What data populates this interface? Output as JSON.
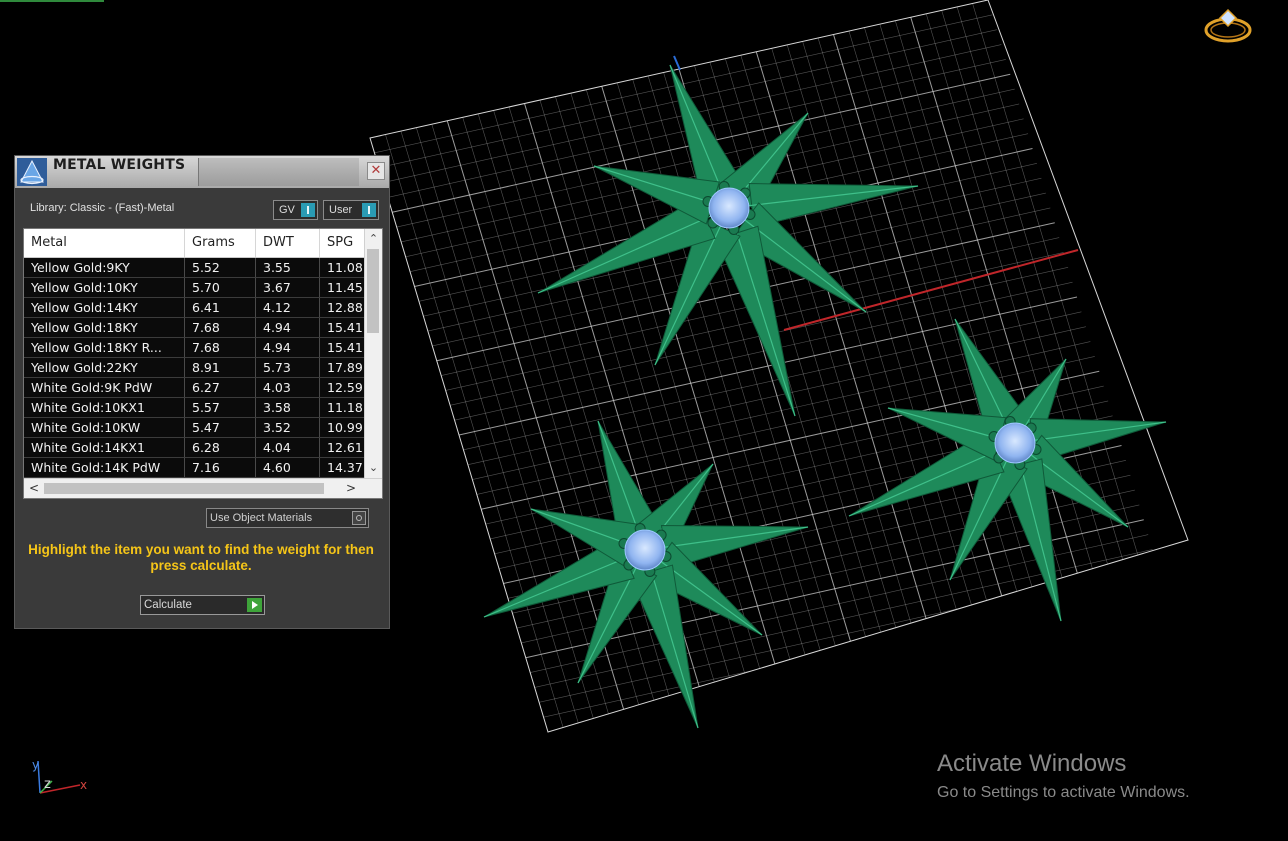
{
  "panel": {
    "title": "METAL WEIGHTS",
    "close_glyph": "✕",
    "library_label": "Library: Classic - (Fast)-Metal",
    "toggles": {
      "gv_label": "GV",
      "user_label": "User"
    },
    "table": {
      "columns": [
        "Metal",
        "Grams",
        "DWT",
        "SPG"
      ],
      "rows": [
        [
          "Yellow Gold:9KY",
          "5.52",
          "3.55",
          "11.08"
        ],
        [
          "Yellow Gold:10KY",
          "5.70",
          "3.67",
          "11.45"
        ],
        [
          "Yellow Gold:14KY",
          "6.41",
          "4.12",
          "12.88"
        ],
        [
          "Yellow Gold:18KY",
          "7.68",
          "4.94",
          "15.41"
        ],
        [
          "Yellow Gold:18KY R...",
          "7.68",
          "4.94",
          "15.41"
        ],
        [
          "Yellow Gold:22KY",
          "8.91",
          "5.73",
          "17.89"
        ],
        [
          "White Gold:9K PdW",
          "6.27",
          "4.03",
          "12.59"
        ],
        [
          "White Gold:10KX1",
          "5.57",
          "3.58",
          "11.18"
        ],
        [
          "White Gold:10KW",
          "5.47",
          "3.52",
          "10.99"
        ],
        [
          "White Gold:14KX1",
          "6.28",
          "4.04",
          "12.61"
        ],
        [
          "White Gold:14K PdW",
          "7.16",
          "4.60",
          "14.37"
        ]
      ]
    },
    "scroll_glyphs": {
      "up": "⌃",
      "down": "⌄",
      "left": "<",
      "right": ">"
    },
    "use_object_materials_label": "Use Object Materials",
    "instruction": "Highlight the item you want to find the weight for then press calculate.",
    "calculate_label": "Calculate"
  },
  "viewport": {
    "axis_labels": {
      "y": "y",
      "z": "z",
      "x": "x"
    },
    "model_color": "#1e8a5a",
    "gem_color": "#9ec8ff",
    "grid_color": "#cfcfcf",
    "axis_line_color": "#c0262a"
  },
  "watermark": {
    "title": "Activate Windows",
    "subtitle": "Go to Settings to activate Windows."
  },
  "icons": [
    "app-logo-icon",
    "close-icon",
    "ring-view-icon",
    "axis-gizmo-icon"
  ]
}
